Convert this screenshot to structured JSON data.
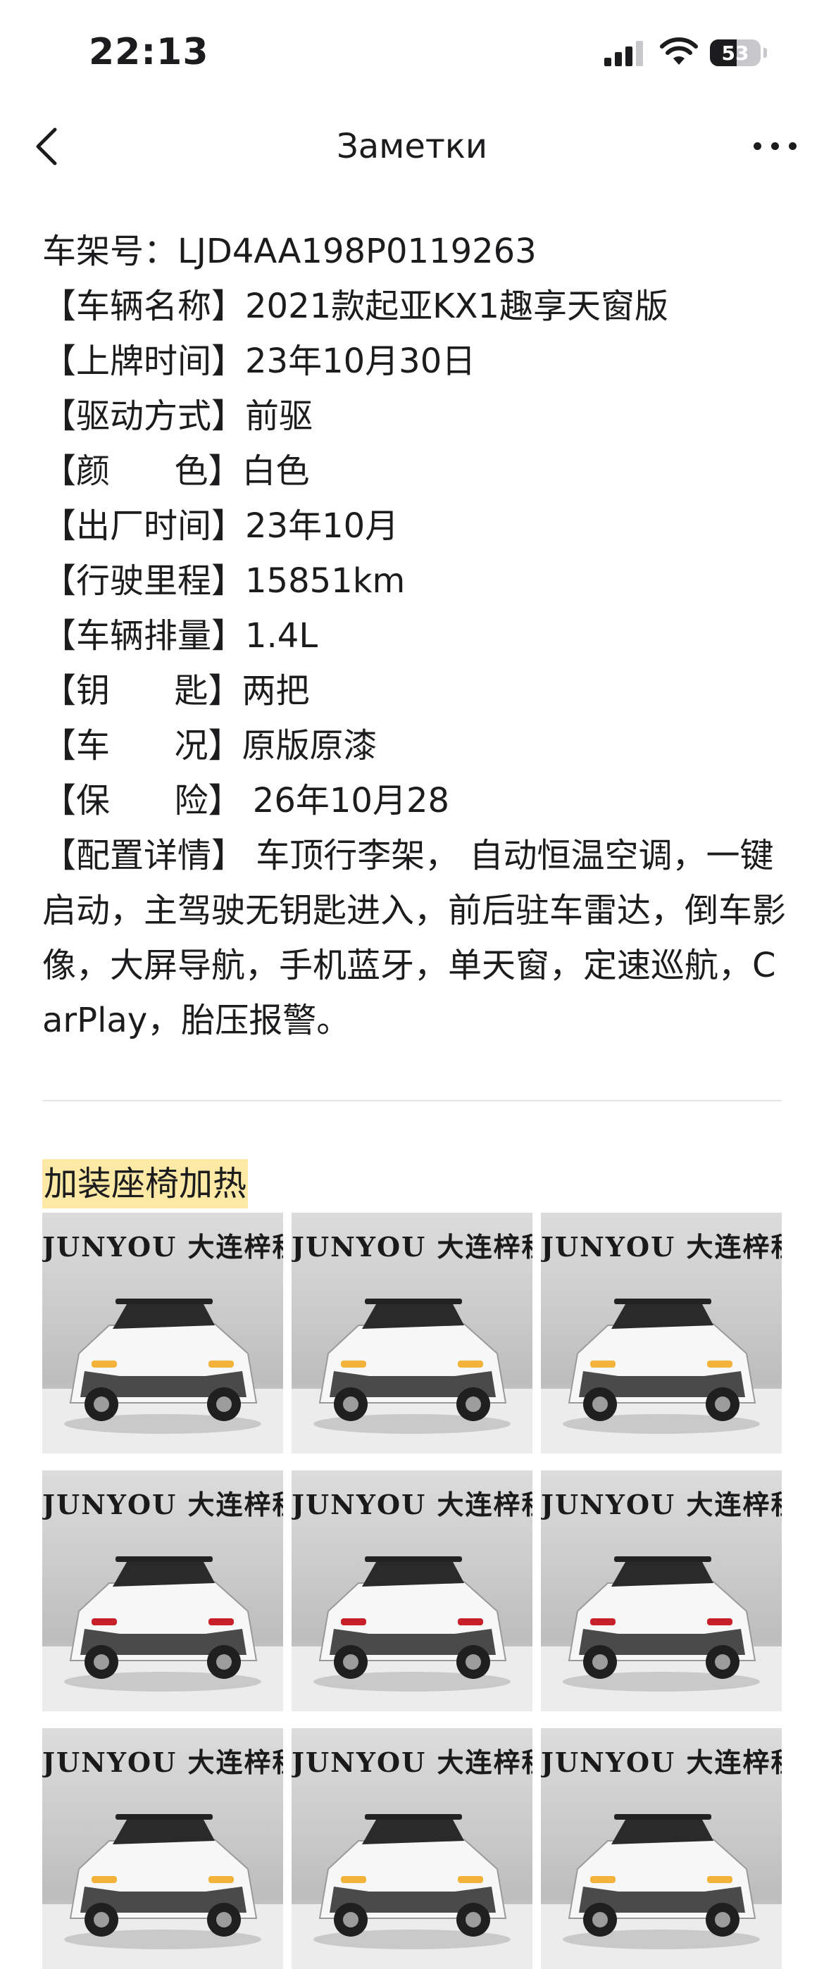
{
  "status": {
    "time": "22:13",
    "battery": "53",
    "battery_level": 0.53
  },
  "nav": {
    "title": "Заметки"
  },
  "note": {
    "lines": [
      "车架号：LJD4AA198P0119263",
      "【车辆名称】2021款起亚KX1趣享天窗版",
      "【上牌时间】23年10月30日",
      "【驱动方式】前驱",
      "【颜      色】白色",
      "【出厂时间】23年10月",
      "【行驶里程】15851km",
      "【车辆排量】1.4L",
      "【钥      匙】两把",
      "【车      况】原版原漆",
      "【保      险】 26年10月28"
    ],
    "config": "【配置详情】  车顶行李架， 自动恒温空调，一键启动，主驾驶无钥匙进入，前后驻车雷达，倒车影像，大屏导航，手机蓝牙，单天窗，定速巡航，CarPlay，胎压报警。",
    "highlight": "加装座椅加热"
  },
  "photos": {
    "brand": "JUNYOU 大连梓程",
    "items": [
      {
        "view": "front-left"
      },
      {
        "view": "front"
      },
      {
        "view": "front-right"
      },
      {
        "view": "rear-left"
      },
      {
        "view": "rear"
      },
      {
        "view": "rear-right"
      },
      {
        "view": "side"
      },
      {
        "view": "side"
      },
      {
        "view": "interior"
      }
    ]
  }
}
